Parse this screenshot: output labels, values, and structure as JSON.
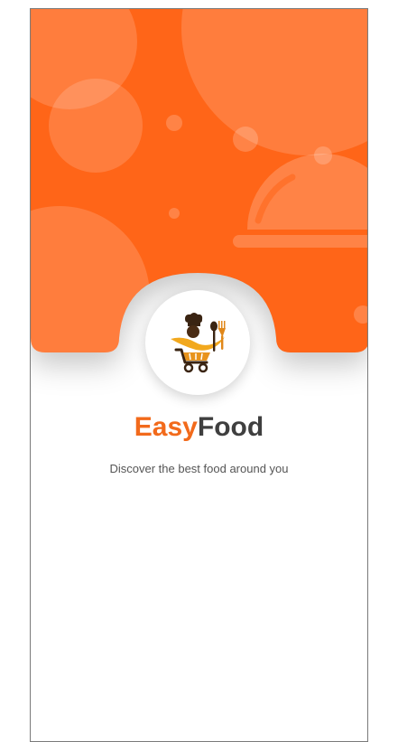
{
  "app": {
    "brand_first": "Easy",
    "brand_second": "Food",
    "tagline": "Discover the best food around you"
  },
  "icons": {
    "logo": "food-cart-chef-logo-icon",
    "decoration": "serving-cloche-icon"
  },
  "colors": {
    "primary_orange": "#ff6518",
    "accent_orange": "#f26a1b",
    "dark_text": "#3f3f3f",
    "muted_text": "#555555"
  }
}
